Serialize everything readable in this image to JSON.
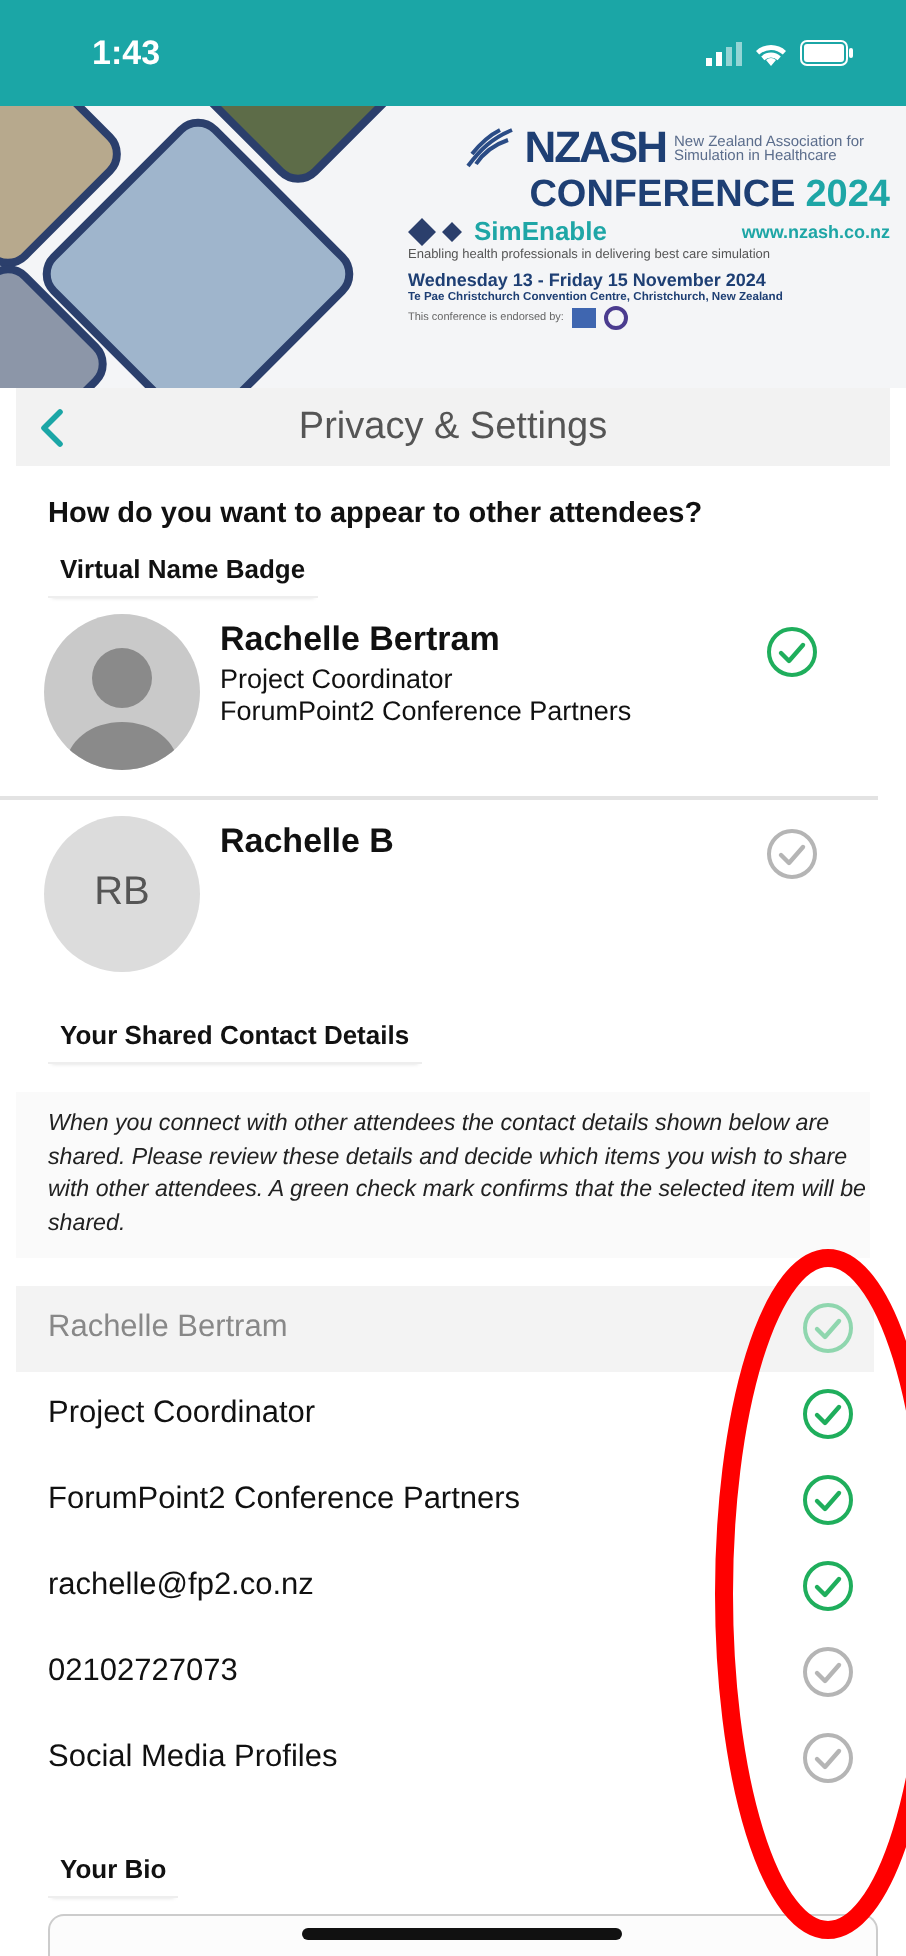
{
  "status_bar": {
    "time": "1:43"
  },
  "banner": {
    "org_name": "NZASH",
    "org_full": "New Zealand Association for Simulation in Healthcare",
    "title": "CONFERENCE",
    "year": "2024",
    "website": "www.nzash.co.nz",
    "theme": "SimEnable",
    "tagline": "Enabling health professionals in delivering best care simulation",
    "dates": "Wednesday 13 - Friday 15 November 2024",
    "venue": "Te Pae Christchurch Convention Centre, Christchurch, New Zealand",
    "endorsed": "This conference is endorsed by:"
  },
  "header": {
    "title": "Privacy & Settings"
  },
  "question": "How do you want to appear to other attendees?",
  "badge_section": {
    "label": "Virtual Name Badge"
  },
  "badges": [
    {
      "kind": "photo",
      "name": "Rachelle Bertram",
      "lines": [
        "Project Coordinator",
        "ForumPoint2 Conference Partners"
      ],
      "selected": true
    },
    {
      "kind": "initials",
      "initials": "RB",
      "name": "Rachelle B",
      "selected": false
    }
  ],
  "contact_section": {
    "label": "Your Shared Contact Details",
    "note": "When you connect with other attendees the contact details shown below are shared. Please review these details and decide which items you wish to share with other attendees. A green check mark confirms that the selected item will be shared."
  },
  "contacts": [
    {
      "text": "Rachelle Bertram",
      "checked": true,
      "disabled": true
    },
    {
      "text": "Project Coordinator",
      "checked": true,
      "disabled": false
    },
    {
      "text": "ForumPoint2 Conference Partners",
      "checked": true,
      "disabled": false
    },
    {
      "text": "rachelle@fp2.co.nz",
      "checked": true,
      "disabled": false
    },
    {
      "text": "02102727073",
      "checked": false,
      "disabled": false
    },
    {
      "text": "Social Media Profiles",
      "checked": false,
      "disabled": false
    }
  ],
  "bio_section": {
    "label": "Your Bio"
  }
}
